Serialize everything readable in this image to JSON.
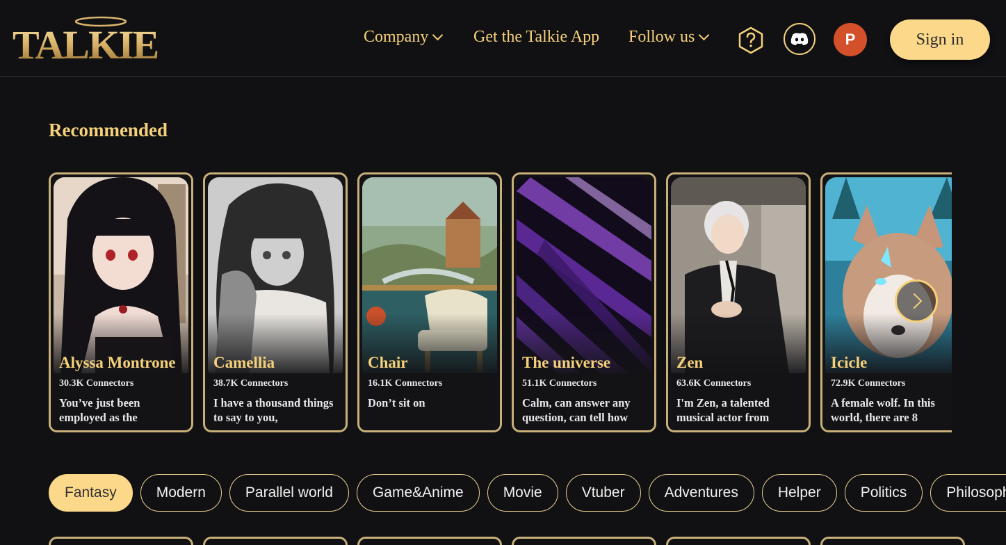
{
  "header": {
    "brand": "TALKIE",
    "nav": {
      "company": "Company",
      "app": "Get the Talkie App",
      "follow": "Follow us"
    },
    "avatar_initial": "P",
    "sign_in": "Sign in"
  },
  "recommended": {
    "title": "Recommended",
    "cards": [
      {
        "name": "Alyssa Montrone",
        "connectors": "30.3K Connectors",
        "desc": "You’ve just been employed as the"
      },
      {
        "name": "Camellia",
        "connectors": "38.7K Connectors",
        "desc": "I have a thousand things to say to you,"
      },
      {
        "name": "Chair",
        "connectors": "16.1K Connectors",
        "desc": "Don’t sit on"
      },
      {
        "name": "The universe",
        "connectors": "51.1K Connectors",
        "desc": "Calm, can answer any question, can tell how"
      },
      {
        "name": "Zen",
        "connectors": "63.6K Connectors",
        "desc": "I'm Zen, a talented musical actor from"
      },
      {
        "name": "Icicle",
        "connectors": "72.9K Connectors",
        "desc": "A female wolf. In this world, there are 8"
      }
    ]
  },
  "categories": [
    "Fantasy",
    "Modern",
    "Parallel world",
    "Game&Anime",
    "Movie",
    "Vtuber",
    "Adventures",
    "Helper",
    "Politics",
    "Philosophy"
  ],
  "colors": {
    "accent": "#f5d17a",
    "background": "#111114",
    "button": "#fcd88a",
    "avatar": "#d3502a"
  }
}
